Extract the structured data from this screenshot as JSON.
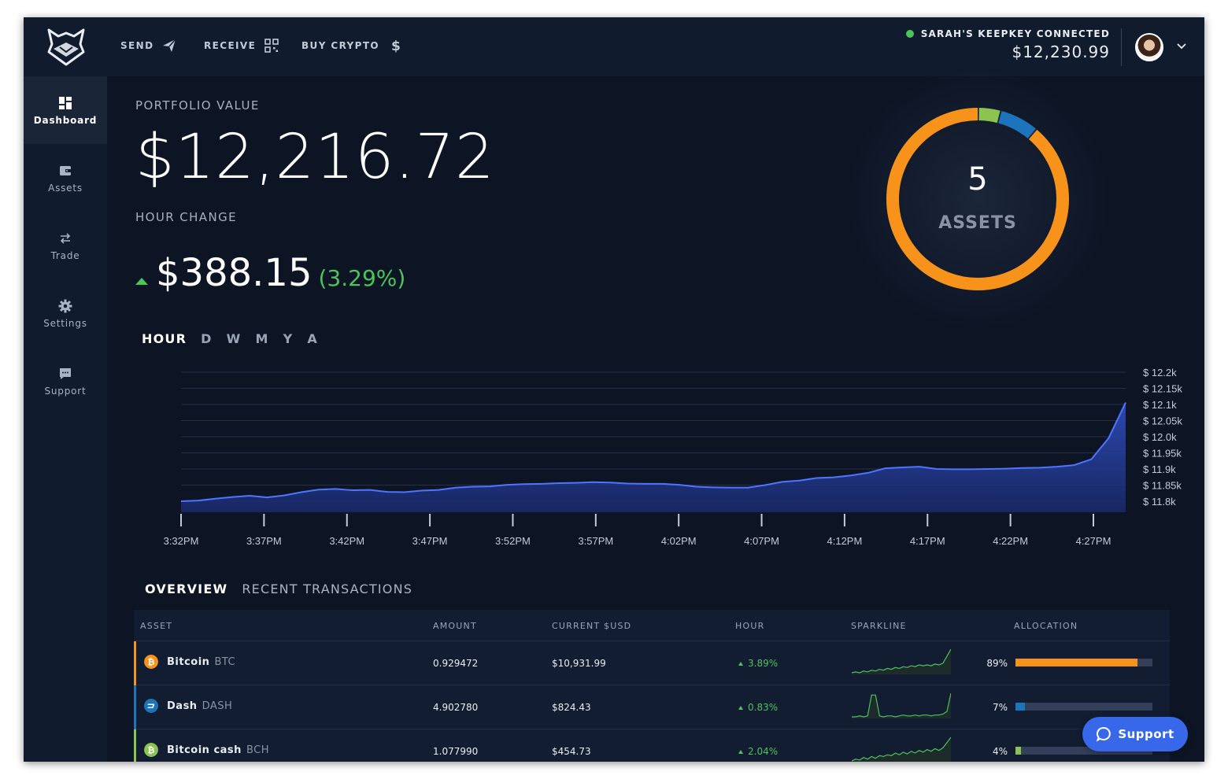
{
  "topbar": {
    "send_label": "SEND",
    "receive_label": "RECEIVE",
    "buy_label": "BUY CRYPTO",
    "wallet_status": "SARAH'S KEEPKEY CONNECTED",
    "wallet_balance": "$12,230.99",
    "status_color": "#4cc35b"
  },
  "sidebar": {
    "items": [
      {
        "label": "Dashboard",
        "icon": "dashboard-icon"
      },
      {
        "label": "Assets",
        "icon": "wallet-icon"
      },
      {
        "label": "Trade",
        "icon": "swap-icon"
      },
      {
        "label": "Settings",
        "icon": "gear-icon"
      },
      {
        "label": "Support",
        "icon": "chat-icon"
      }
    ]
  },
  "portfolio": {
    "label": "PORTFOLIO VALUE",
    "value": "$12,216.72",
    "change_label": "HOUR CHANGE",
    "change_amount": "$388.15",
    "change_pct": "(3.29%)"
  },
  "donut": {
    "count": "5",
    "label": "ASSETS",
    "segments": [
      {
        "color": "#f7931a",
        "pct": 89
      },
      {
        "color": "#1c75bc",
        "pct": 7
      },
      {
        "color": "#8dc351",
        "pct": 4
      }
    ]
  },
  "range_tabs": [
    "HOUR",
    "D",
    "W",
    "M",
    "Y",
    "A"
  ],
  "chart_data": {
    "type": "area",
    "x_ticks": [
      "3:32PM",
      "3:37PM",
      "3:42PM",
      "3:47PM",
      "3:52PM",
      "3:57PM",
      "4:02PM",
      "4:07PM",
      "4:12PM",
      "4:17PM",
      "4:22PM",
      "4:27PM"
    ],
    "y_ticks": [
      "$ 12.2k",
      "$ 12.15k",
      "$ 12.1k",
      "$ 12.05k",
      "$ 12.0k",
      "$ 11.95k",
      "$ 11.9k",
      "$ 11.85k",
      "$ 11.8k"
    ],
    "ylim": [
      11800,
      12200
    ],
    "values": [
      11800,
      11802,
      11808,
      11813,
      11817,
      11812,
      11818,
      11828,
      11836,
      11838,
      11834,
      11835,
      11829,
      11828,
      11833,
      11835,
      11842,
      11845,
      11846,
      11851,
      11853,
      11854,
      11856,
      11857,
      11859,
      11858,
      11855,
      11854,
      11854,
      11851,
      11845,
      11843,
      11842,
      11842,
      11850,
      11860,
      11864,
      11872,
      11874,
      11880,
      11888,
      11902,
      11905,
      11907,
      11900,
      11899,
      11899,
      11900,
      11901,
      11903,
      11904,
      11907,
      11912,
      11930,
      11995,
      12106
    ],
    "grid": true,
    "fill_color": "#2d4bb8",
    "line_color": "#4f74ff"
  },
  "tabs": [
    "OVERVIEW",
    "RECENT TRANSACTIONS"
  ],
  "table": {
    "headers": [
      "ASSET",
      "AMOUNT",
      "CURRENT $USD",
      "HOUR",
      "SPARKLINE",
      "ALLOCATION"
    ],
    "rows": [
      {
        "name": "Bitcoin",
        "symbol": "BTC",
        "amount": "0.929472",
        "usd": "$10,931.99",
        "hour": "3.89%",
        "allocation": "89%",
        "alloc_value": 89,
        "color": "#f7931a",
        "spark": [
          3,
          4,
          3,
          5,
          4,
          6,
          5,
          7,
          6,
          8,
          7,
          9,
          8,
          10,
          9,
          11,
          10,
          12,
          11,
          12,
          11,
          13,
          12,
          14,
          22,
          30
        ]
      },
      {
        "name": "Dash",
        "symbol": "DASH",
        "amount": "4.902780",
        "usd": "$824.43",
        "hour": "0.83%",
        "allocation": "7%",
        "alloc_value": 7,
        "color": "#1c75bc",
        "spark": [
          4,
          4,
          5,
          4,
          5,
          28,
          28,
          5,
          4,
          5,
          5,
          4,
          5,
          6,
          5,
          5,
          6,
          5,
          6,
          6,
          5,
          6,
          6,
          7,
          10,
          30
        ]
      },
      {
        "name": "Bitcoin cash",
        "symbol": "BCH",
        "amount": "1.077990",
        "usd": "$454.73",
        "hour": "2.04%",
        "allocation": "4%",
        "alloc_value": 4,
        "color": "#8dc351",
        "spark": [
          3,
          5,
          4,
          7,
          5,
          8,
          6,
          9,
          8,
          10,
          9,
          12,
          10,
          13,
          11,
          14,
          12,
          15,
          13,
          16,
          14,
          17,
          15,
          18,
          24,
          30
        ]
      }
    ]
  },
  "support_button": "Support",
  "accent_color": "#3868ea",
  "positive_color": "#4cc35b"
}
